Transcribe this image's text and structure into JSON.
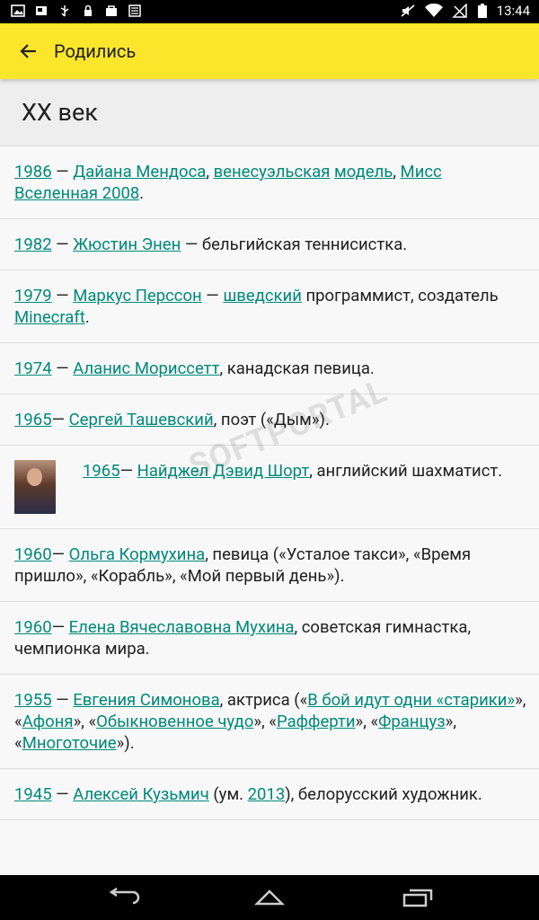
{
  "status": {
    "time": "13:44"
  },
  "toolbar": {
    "title": "Родились"
  },
  "section": {
    "heading": "XX век"
  },
  "watermark": {
    "text": "SOFTPORTAL"
  },
  "items": [
    {
      "p": [
        {
          "t": "1986",
          "l": true
        },
        {
          "t": " — "
        },
        {
          "t": "Дайана Мендоса",
          "l": true
        },
        {
          "t": ", "
        },
        {
          "t": "венесуэльская",
          "l": true
        },
        {
          "t": " "
        },
        {
          "t": "модель",
          "l": true
        },
        {
          "t": ", "
        },
        {
          "t": "Мисс Вселенная 2008",
          "l": true
        },
        {
          "t": "."
        }
      ]
    },
    {
      "p": [
        {
          "t": "1982",
          "l": true
        },
        {
          "t": " — "
        },
        {
          "t": "Жюстин Энен",
          "l": true
        },
        {
          "t": " — бельгийская теннисистка."
        }
      ]
    },
    {
      "p": [
        {
          "t": "1979",
          "l": true
        },
        {
          "t": " — "
        },
        {
          "t": "Маркус Перссон",
          "l": true
        },
        {
          "t": " — "
        },
        {
          "t": "шведский",
          "l": true
        },
        {
          "t": " программист, создатель "
        },
        {
          "t": "Minecraft",
          "l": true
        },
        {
          "t": "."
        }
      ]
    },
    {
      "p": [
        {
          "t": "1974",
          "l": true
        },
        {
          "t": " — "
        },
        {
          "t": "Аланис Мориссетт",
          "l": true
        },
        {
          "t": ", канадская певица."
        }
      ]
    },
    {
      "p": [
        {
          "t": "1965",
          "l": true
        },
        {
          "t": "— "
        },
        {
          "t": "Сергей Ташевский",
          "l": true
        },
        {
          "t": ", поэт («Дым»)."
        }
      ]
    },
    {
      "img": true,
      "p": [
        {
          "t": "1965",
          "l": true
        },
        {
          "t": "— "
        },
        {
          "t": "Найджел Дэвид Шорт",
          "l": true
        },
        {
          "t": ", английский шахматист."
        }
      ]
    },
    {
      "p": [
        {
          "t": "1960",
          "l": true
        },
        {
          "t": "— "
        },
        {
          "t": "Ольга Кормухина",
          "l": true
        },
        {
          "t": ", певица («Усталое такси», «Время пришло», «Корабль», «Мой первый день»)."
        }
      ]
    },
    {
      "p": [
        {
          "t": "1960",
          "l": true
        },
        {
          "t": "— "
        },
        {
          "t": "Елена Вячеславовна Мухина",
          "l": true
        },
        {
          "t": ", советская гимнастка, чемпионка мира."
        }
      ]
    },
    {
      "p": [
        {
          "t": "1955",
          "l": true
        },
        {
          "t": " — "
        },
        {
          "t": "Евгения Симонова",
          "l": true
        },
        {
          "t": ", актриса («"
        },
        {
          "t": "В бой идут одни «старики»",
          "l": true
        },
        {
          "t": "», «"
        },
        {
          "t": "Афоня",
          "l": true
        },
        {
          "t": "», «"
        },
        {
          "t": "Обыкновенное чудо",
          "l": true
        },
        {
          "t": "», «"
        },
        {
          "t": "Рафферти",
          "l": true
        },
        {
          "t": "», «"
        },
        {
          "t": "Француз",
          "l": true
        },
        {
          "t": "», «"
        },
        {
          "t": "Многоточие",
          "l": true
        },
        {
          "t": "»)."
        }
      ]
    },
    {
      "p": [
        {
          "t": "1945",
          "l": true
        },
        {
          "t": " — "
        },
        {
          "t": "Алексей Кузьмич",
          "l": true
        },
        {
          "t": " (ум. "
        },
        {
          "t": "2013",
          "l": true
        },
        {
          "t": "), белорусский художник."
        }
      ]
    }
  ]
}
